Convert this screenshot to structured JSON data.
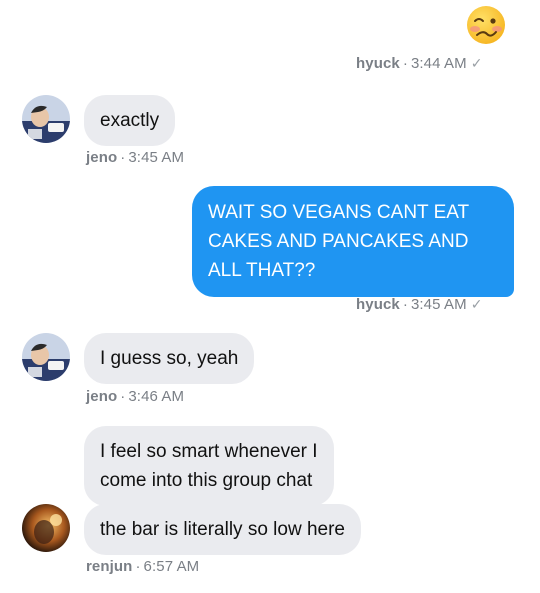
{
  "messages": [
    {
      "sender": "hyuck",
      "time": "3:44 AM",
      "status": "✓",
      "emoji": "woozy-face"
    },
    {
      "sender": "jeno",
      "time": "3:45 AM",
      "text": "exactly"
    },
    {
      "sender": "hyuck",
      "time": "3:45 AM",
      "status": "✓",
      "lines": [
        "WAIT SO VEGANS CANT EAT",
        "CAKES AND PANCAKES AND",
        "ALL THAT??"
      ]
    },
    {
      "sender": "jeno",
      "time": "3:46 AM",
      "text": "I guess so, yeah"
    },
    {
      "sender": "renjun",
      "time": "6:57 AM",
      "lines": [
        "I feel so smart whenever I",
        "come into this group chat"
      ],
      "text2": "the bar is literally so low here"
    }
  ],
  "separator": "·",
  "colors": {
    "outgoing_bubble": "#1f95f2",
    "incoming_bubble": "#eaebef",
    "meta_text": "#7a7f86"
  }
}
